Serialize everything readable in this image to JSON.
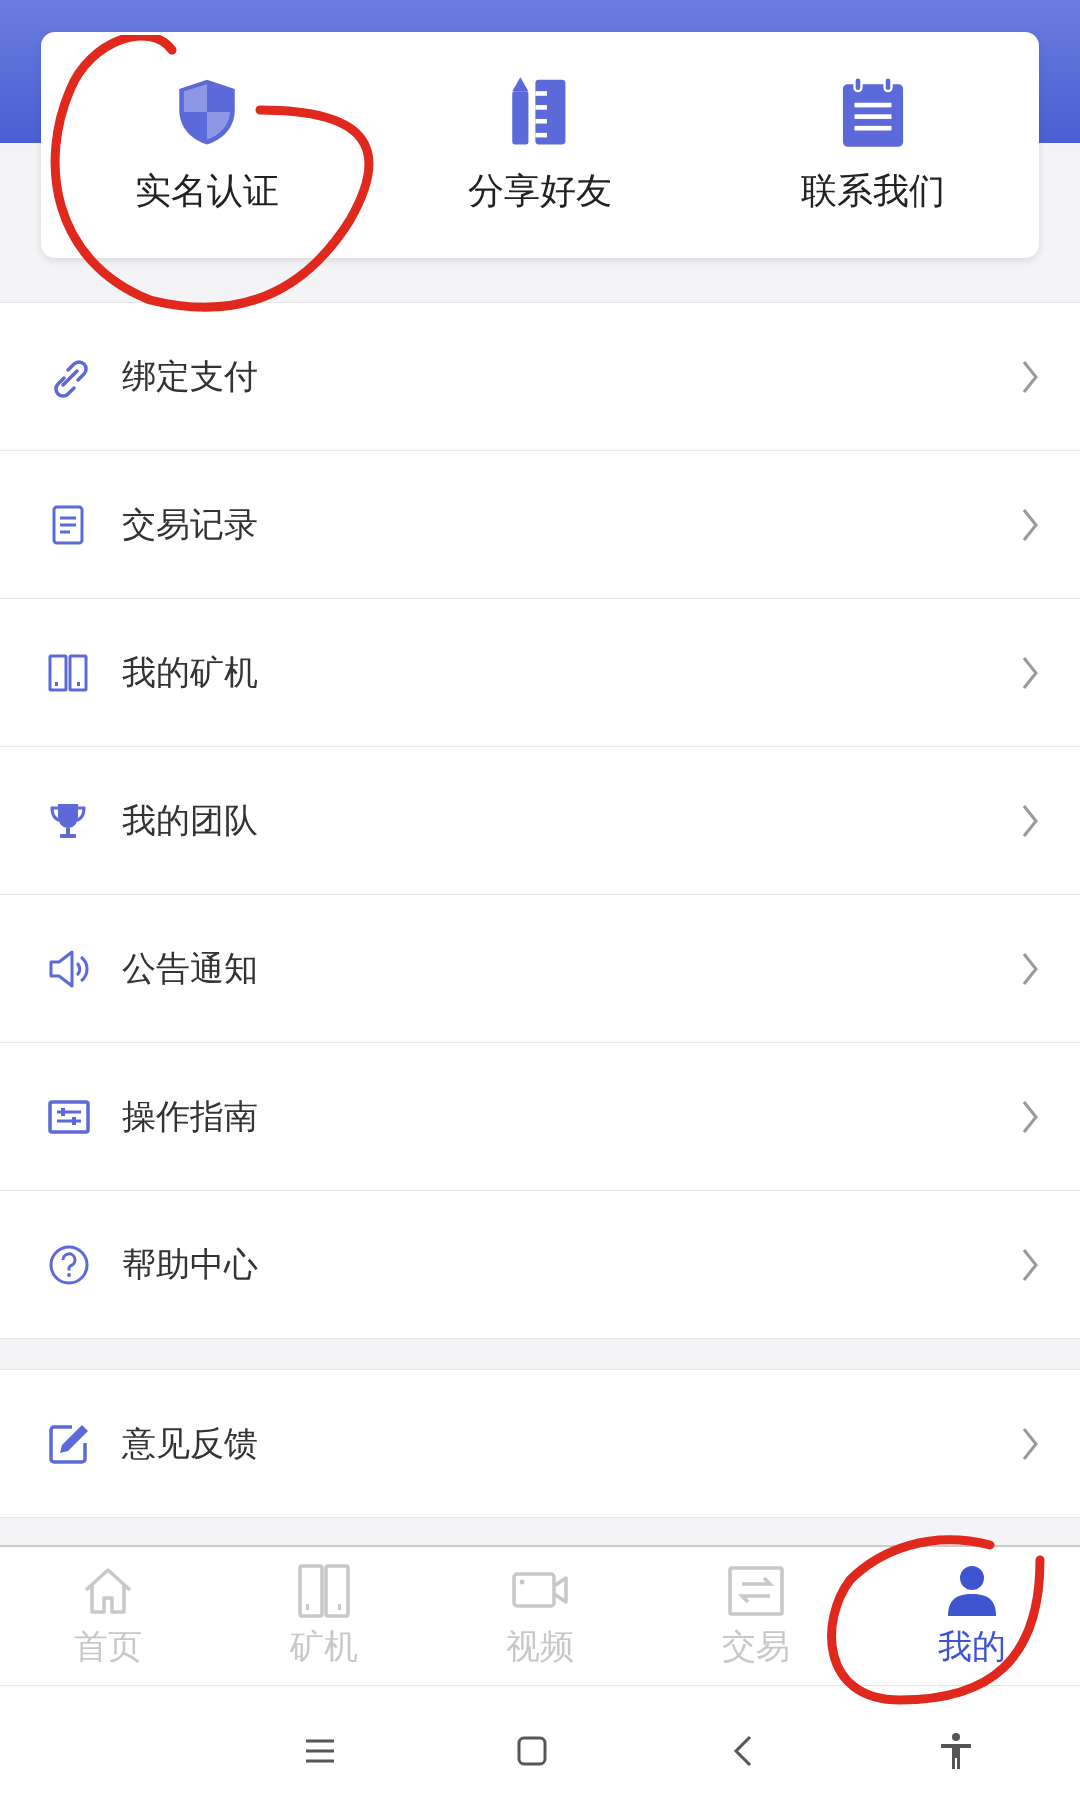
{
  "quick_actions": [
    {
      "label": "实名认证"
    },
    {
      "label": "分享好友"
    },
    {
      "label": "联系我们"
    }
  ],
  "menu_groups": [
    {
      "items": [
        {
          "label": "绑定支付"
        },
        {
          "label": "交易记录"
        },
        {
          "label": "我的矿机"
        },
        {
          "label": "我的团队"
        },
        {
          "label": "公告通知"
        },
        {
          "label": "操作指南"
        },
        {
          "label": "帮助中心"
        }
      ]
    },
    {
      "items": [
        {
          "label": "意见反馈"
        }
      ]
    }
  ],
  "tab_bar": [
    {
      "label": "首页",
      "selected": false
    },
    {
      "label": "矿机",
      "selected": false
    },
    {
      "label": "视频",
      "selected": false
    },
    {
      "label": "交易",
      "selected": false
    },
    {
      "label": "我的",
      "selected": true
    }
  ],
  "annotations": [
    {
      "kind": "freehand-circle"
    },
    {
      "kind": "freehand-circle"
    }
  ]
}
